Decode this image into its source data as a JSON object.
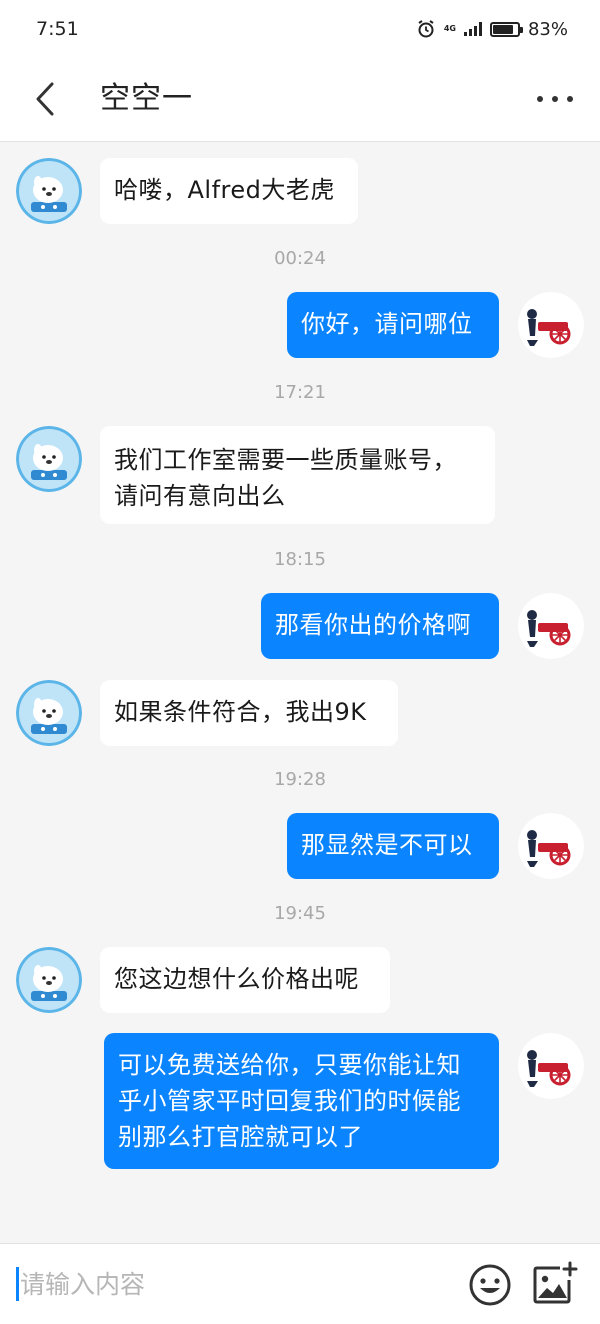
{
  "status_bar": {
    "time": "7:51",
    "network": "4G",
    "battery": "83%",
    "battery_level": 0.83
  },
  "header": {
    "title": "空空一",
    "back_icon": "chevron-left-icon",
    "more_icon": "more-horizontal-icon"
  },
  "messages": [
    {
      "from": "other",
      "text": "哈喽，Alfred大老虎"
    },
    {
      "time": "00:24"
    },
    {
      "from": "me",
      "text": "你好，请问哪位"
    },
    {
      "time": "17:21"
    },
    {
      "from": "other",
      "text": "我们工作室需要一些质量账号，请问有意向出么"
    },
    {
      "time": "18:15"
    },
    {
      "from": "me",
      "text": "那看你出的价格啊"
    },
    {
      "from": "other",
      "text": "如果条件符合，我出9K"
    },
    {
      "time": "19:28"
    },
    {
      "from": "me",
      "text": "那显然是不可以"
    },
    {
      "time": "19:45"
    },
    {
      "from": "other",
      "text": "您这边想什么价格出呢"
    },
    {
      "from": "me",
      "text": "可以免费送给你，只要你能让知乎小管家平时回复我们的时候能别那么打官腔就可以了"
    }
  ],
  "input": {
    "placeholder": "请输入内容",
    "value": ""
  },
  "icons": {
    "emoji": "emoji-icon",
    "image": "add-image-icon"
  },
  "colors": {
    "accent": "#0a84ff",
    "background": "#f5f5f5",
    "incoming_bubble": "#ffffff",
    "outgoing_bubble": "#0a84ff",
    "timestamp": "#a8a8a8"
  }
}
